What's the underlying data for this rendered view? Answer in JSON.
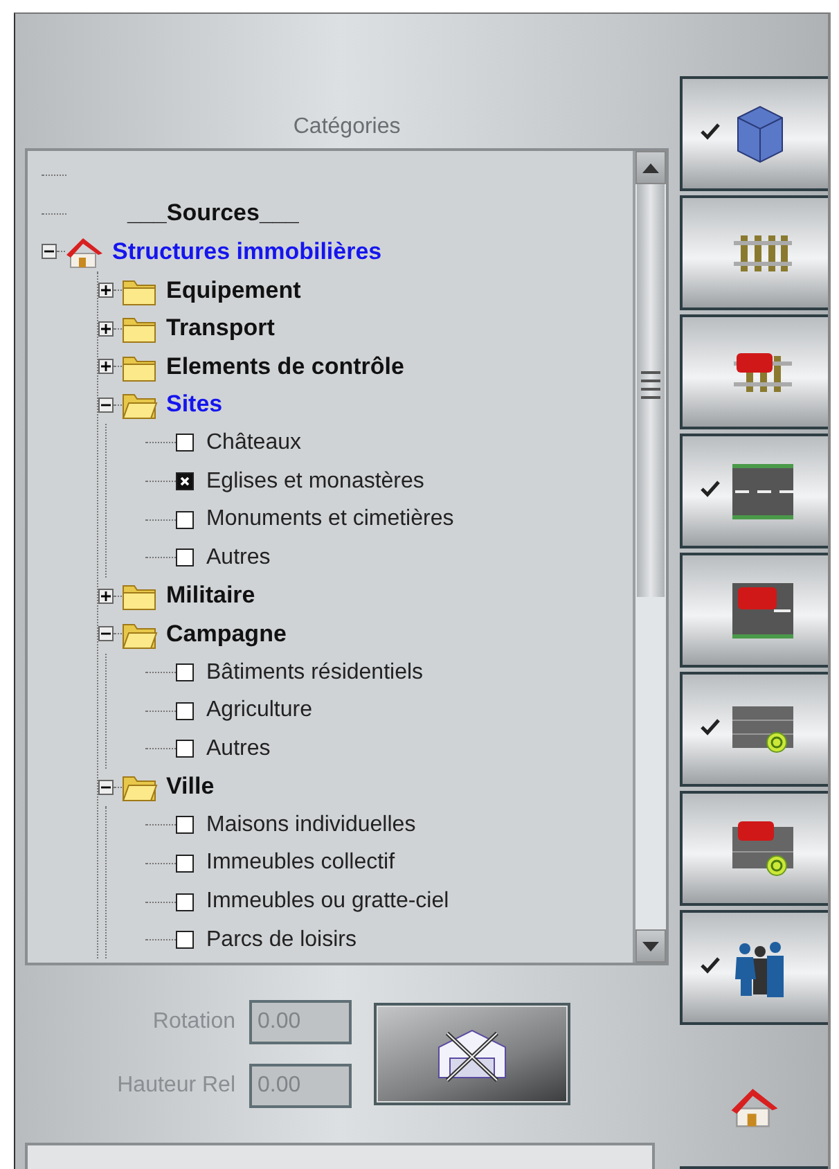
{
  "panel": {
    "title": "Catégories"
  },
  "tree": [
    {
      "kind": "blank"
    },
    {
      "kind": "heading",
      "label": "___Sources___"
    },
    {
      "kind": "house",
      "label": "Structures immobilières",
      "selected": true,
      "expanded": true,
      "children": [
        {
          "kind": "folder",
          "label": "Equipement",
          "selected": false,
          "expanded": false
        },
        {
          "kind": "folder",
          "label": "Transport",
          "selected": false,
          "expanded": false
        },
        {
          "kind": "folder",
          "label": "Elements de contrôle",
          "selected": false,
          "expanded": false
        },
        {
          "kind": "folder",
          "label": "Sites",
          "selected": true,
          "expanded": true,
          "children": [
            {
              "kind": "check",
              "label": "Châteaux",
              "checked": false
            },
            {
              "kind": "check",
              "label": "Eglises et monastères",
              "checked": true
            },
            {
              "kind": "check",
              "label": "Monuments et cimetières",
              "checked": false
            },
            {
              "kind": "check",
              "label": "Autres",
              "checked": false
            }
          ]
        },
        {
          "kind": "folder",
          "label": "Militaire",
          "selected": false,
          "expanded": false
        },
        {
          "kind": "folder",
          "label": "Campagne",
          "selected": false,
          "expanded": true,
          "children": [
            {
              "kind": "check",
              "label": "Bâtiments résidentiels",
              "checked": false
            },
            {
              "kind": "check",
              "label": "Agriculture",
              "checked": false
            },
            {
              "kind": "check",
              "label": "Autres",
              "checked": false
            }
          ]
        },
        {
          "kind": "folder",
          "label": "Ville",
          "selected": false,
          "expanded": true,
          "children": [
            {
              "kind": "check",
              "label": "Maisons individuelles",
              "checked": false
            },
            {
              "kind": "check",
              "label": "Immeubles collectif",
              "checked": false
            },
            {
              "kind": "check",
              "label": "Immeubles ou gratte-ciel",
              "checked": false
            },
            {
              "kind": "check",
              "label": "Parcs de loisirs",
              "checked": false
            }
          ]
        }
      ]
    }
  ],
  "fields": [
    {
      "label": "Rotation",
      "value": "0.00",
      "disabled": true
    },
    {
      "label": "Hauteur Rel",
      "value": "0.00",
      "disabled": true
    }
  ],
  "side_buttons": [
    {
      "kind": "cube",
      "checked": true
    },
    {
      "kind": "rails",
      "checked": false
    },
    {
      "kind": "wagon-rails",
      "checked": false
    },
    {
      "kind": "road",
      "checked": true
    },
    {
      "kind": "wagon-road",
      "checked": false
    },
    {
      "kind": "road-stop",
      "checked": true
    },
    {
      "kind": "wagon-road-stop",
      "checked": false
    },
    {
      "kind": "people",
      "checked": true
    }
  ]
}
